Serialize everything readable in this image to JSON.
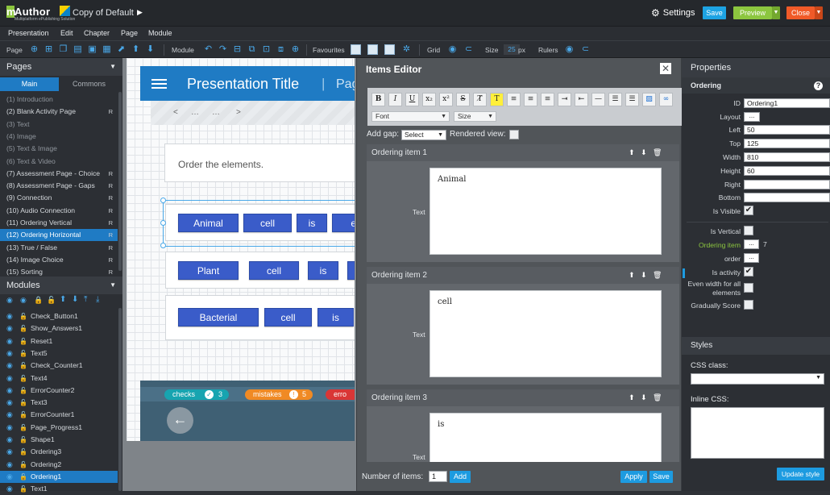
{
  "app": {
    "logo_mark": "m",
    "logo_text": "Author",
    "logo_sub": "Multiplatform ePublishing Solution",
    "doc_title": "Copy of Default",
    "doc_arrow": "▶",
    "settings_label": "Settings",
    "save_label": "Save",
    "preview_label": "Preview",
    "close_label": "Close",
    "dropdown_glyph": "▼"
  },
  "menu": [
    "Presentation",
    "Edit",
    "Chapter",
    "Page",
    "Module"
  ],
  "toolbar": {
    "page_label": "Page",
    "module_label": "Module",
    "favourites_label": "Favourites",
    "grid_label": "Grid",
    "size_label": "Size",
    "size_value": "25",
    "size_unit": "px",
    "rulers_label": "Rulers"
  },
  "pages_panel": {
    "title": "Pages",
    "tab_main": "Main",
    "tab_commons": "Commons",
    "items": [
      {
        "label": "(1) Introduction",
        "r": ""
      },
      {
        "label": "(2) Blank Activity Page",
        "r": "R"
      },
      {
        "label": "(3) Text",
        "r": ""
      },
      {
        "label": "(4) Image",
        "r": ""
      },
      {
        "label": "(5) Text & Image",
        "r": ""
      },
      {
        "label": "(6) Text & Video",
        "r": ""
      },
      {
        "label": "(7) Assessment Page - Choice",
        "r": "R"
      },
      {
        "label": "(8) Assessment Page - Gaps",
        "r": "R"
      },
      {
        "label": "(9) Connection",
        "r": "R"
      },
      {
        "label": "(10) Audio Connection",
        "r": "R"
      },
      {
        "label": "(11) Ordering Vertical",
        "r": "R"
      },
      {
        "label": "(12) Ordering Horizontal",
        "r": "R"
      },
      {
        "label": "(13) True / False",
        "r": "R"
      },
      {
        "label": "(14) Image Choice",
        "r": "R"
      },
      {
        "label": "(15) Sorting",
        "r": "R"
      }
    ]
  },
  "modules_panel": {
    "title": "Modules",
    "items": [
      "Check_Button1",
      "Show_Answers1",
      "Reset1",
      "Text5",
      "Check_Counter1",
      "Text4",
      "ErrorCounter2",
      "Text3",
      "ErrorCounter1",
      "Page_Progress1",
      "Shape1",
      "Ordering3",
      "Ordering2",
      "Ordering1",
      "Text1"
    ]
  },
  "canvas": {
    "title": "Presentation Title",
    "separator": "|",
    "page_label": "Pag",
    "nav": [
      "<",
      "…",
      "…",
      ">"
    ],
    "question": "Order the elements.",
    "rows": [
      [
        "Animal",
        "cell",
        "is",
        "en"
      ],
      [
        "Plant",
        "cell",
        "is",
        ""
      ],
      [
        "Bacterial",
        "cell",
        "is",
        ""
      ]
    ],
    "checks_label": "checks",
    "checks_value": "3",
    "mistakes_label": "mistakes",
    "mistakes_value": "5",
    "errors_label": "erro",
    "back_glyph": "←"
  },
  "editor": {
    "title": "Items Editor",
    "close_glyph": "✕",
    "font_select": "Font",
    "size_select": "Size",
    "add_gap_label": "Add gap:",
    "add_gap_value": "Select",
    "rendered_view_label": "Rendered view:",
    "text_label": "Text",
    "items": [
      {
        "title": "Ordering item 1",
        "text": "Animal"
      },
      {
        "title": "Ordering item 2",
        "text": "cell"
      },
      {
        "title": "Ordering item 3",
        "text": "is"
      }
    ],
    "number_label": "Number of items:",
    "number_value": "1",
    "add_label": "Add",
    "apply_label": "Apply",
    "save_label": "Save"
  },
  "properties": {
    "title": "Properties",
    "section": "Ordering",
    "id_label": "ID",
    "id_value": "Ordering1",
    "layout_label": "Layout",
    "left_label": "Left",
    "left_value": "50",
    "top_label": "Top",
    "top_value": "125",
    "width_label": "Width",
    "width_value": "810",
    "height_label": "Height",
    "height_value": "60",
    "right_label": "Right",
    "bottom_label": "Bottom",
    "visible_label": "Is Visible",
    "vertical_label": "Is Vertical",
    "ordering_item_label": "Ordering item",
    "ordering_item_count": "7",
    "order_label": "order",
    "activity_label": "Is activity",
    "even_width_label": "Even width for all elements",
    "gradually_label": "Gradually Score",
    "ellipsis": "...",
    "check_glyph": "✔",
    "styles_title": "Styles",
    "css_class_label": "CSS class:",
    "inline_css_label": "Inline CSS:",
    "update_label": "Update style",
    "help_glyph": "?"
  },
  "colors": {
    "accent": "#1f7bc4",
    "chip": "#3a5cc9",
    "preview": "#8cc63f",
    "close": "#f05a28",
    "save": "#1da3e3"
  }
}
